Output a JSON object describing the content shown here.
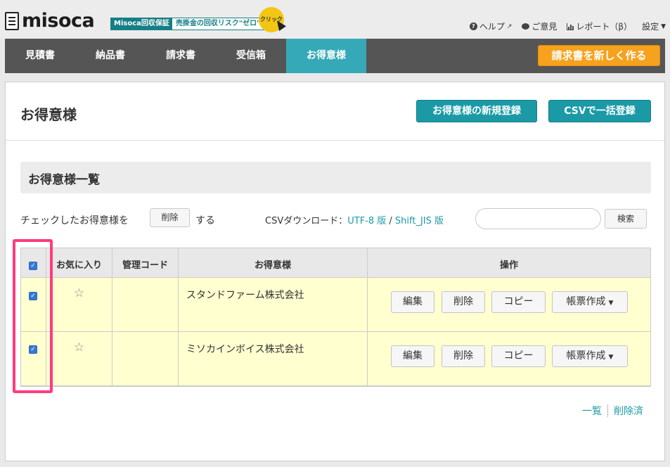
{
  "header": {
    "logo_text": "misoca",
    "promo_service": "Misoca回収保証",
    "promo_tagline": "売掛金の回収リスク\"ゼロ\"",
    "promo_badge": "クリック",
    "links": {
      "help": "ヘルプ",
      "feedback": "ご意見",
      "report": "レポート（β）",
      "settings": "設定"
    }
  },
  "nav": {
    "tabs": [
      "見積書",
      "納品書",
      "請求書",
      "受信箱",
      "お得意様"
    ],
    "active_tab": "お得意様",
    "create_button": "請求書を新しく作る"
  },
  "page": {
    "title": "お得意様",
    "new_client_button": "お得意様の新規登録",
    "csv_import_button": "CSVで一括登録",
    "section_title": "お得意様一覧",
    "bulk_prefix": "チェックしたお得意様を",
    "bulk_delete_button": "削除",
    "bulk_suffix": "する",
    "csv_download_label": "CSVダウンロード：",
    "csv_utf8": "UTF-8 版",
    "csv_sep": " / ",
    "csv_sjis": "Shift_JIS 版",
    "search_value": "",
    "search_button": "検索"
  },
  "table": {
    "headers": {
      "favorite": "お気に入り",
      "code": "管理コード",
      "client": "お得意様",
      "actions": "操作"
    },
    "header_checked": true,
    "rows": [
      {
        "checked": true,
        "favorite": false,
        "code": "",
        "client": "スタンドファーム株式会社"
      },
      {
        "checked": true,
        "favorite": false,
        "code": "",
        "client": "ミソカインボイス株式会社"
      }
    ],
    "row_actions": {
      "edit": "編集",
      "delete": "削除",
      "copy": "コピー",
      "create_doc": "帳票作成"
    }
  },
  "footer": {
    "list_link": "一覧",
    "deleted_link": "削除済"
  },
  "colors": {
    "accent": "#1b9aa6",
    "nav_bg": "#555555",
    "active_tab": "#36a9b8",
    "create_button": "#f6a21e",
    "row_bg": "#ffffd0",
    "highlight": "#ff3b7f"
  }
}
